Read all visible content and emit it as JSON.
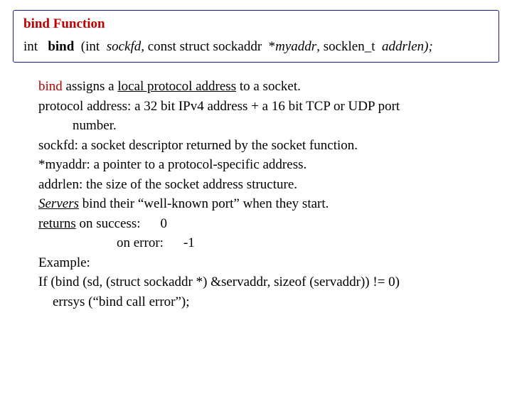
{
  "box": {
    "title": "bind  Function",
    "sig": {
      "p1": "int   ",
      "bind": "bind",
      "p2": "  (int  ",
      "sockfd": "sockfd,",
      "p3": " const struct sockaddr  *",
      "myaddr": "myaddr",
      "p4": ", socklen_t  ",
      "addrlen": "addrlen",
      "p5": ");"
    }
  },
  "desc": {
    "l1a": "bind",
    "l1b": "  assigns a ",
    "l1c": "local protocol address",
    "l1d": " to a socket.",
    "l2": "protocol address: a 32 bit IPv4 address + a 16 bit TCP or UDP port",
    "l2b": "number.",
    "l3": "sockfd: a socket descriptor returned by the socket function.",
    "l4": "*myaddr:  a pointer to a protocol-specific address.",
    "l5": "addrlen: the size of the socket address structure.",
    "l6a": "Servers",
    "l6b": " bind their “well-known port” when they start.",
    "l7a": "returns",
    "l7b": "  on success:",
    "l7c": "0",
    "l8a": "on error:",
    "l8b": "-1",
    "l9": "Example:",
    "l10": "If (bind (sd, (struct sockaddr *) &servaddr, sizeof (servaddr)) != 0)",
    "l11": "errsys (“bind call error”);"
  }
}
